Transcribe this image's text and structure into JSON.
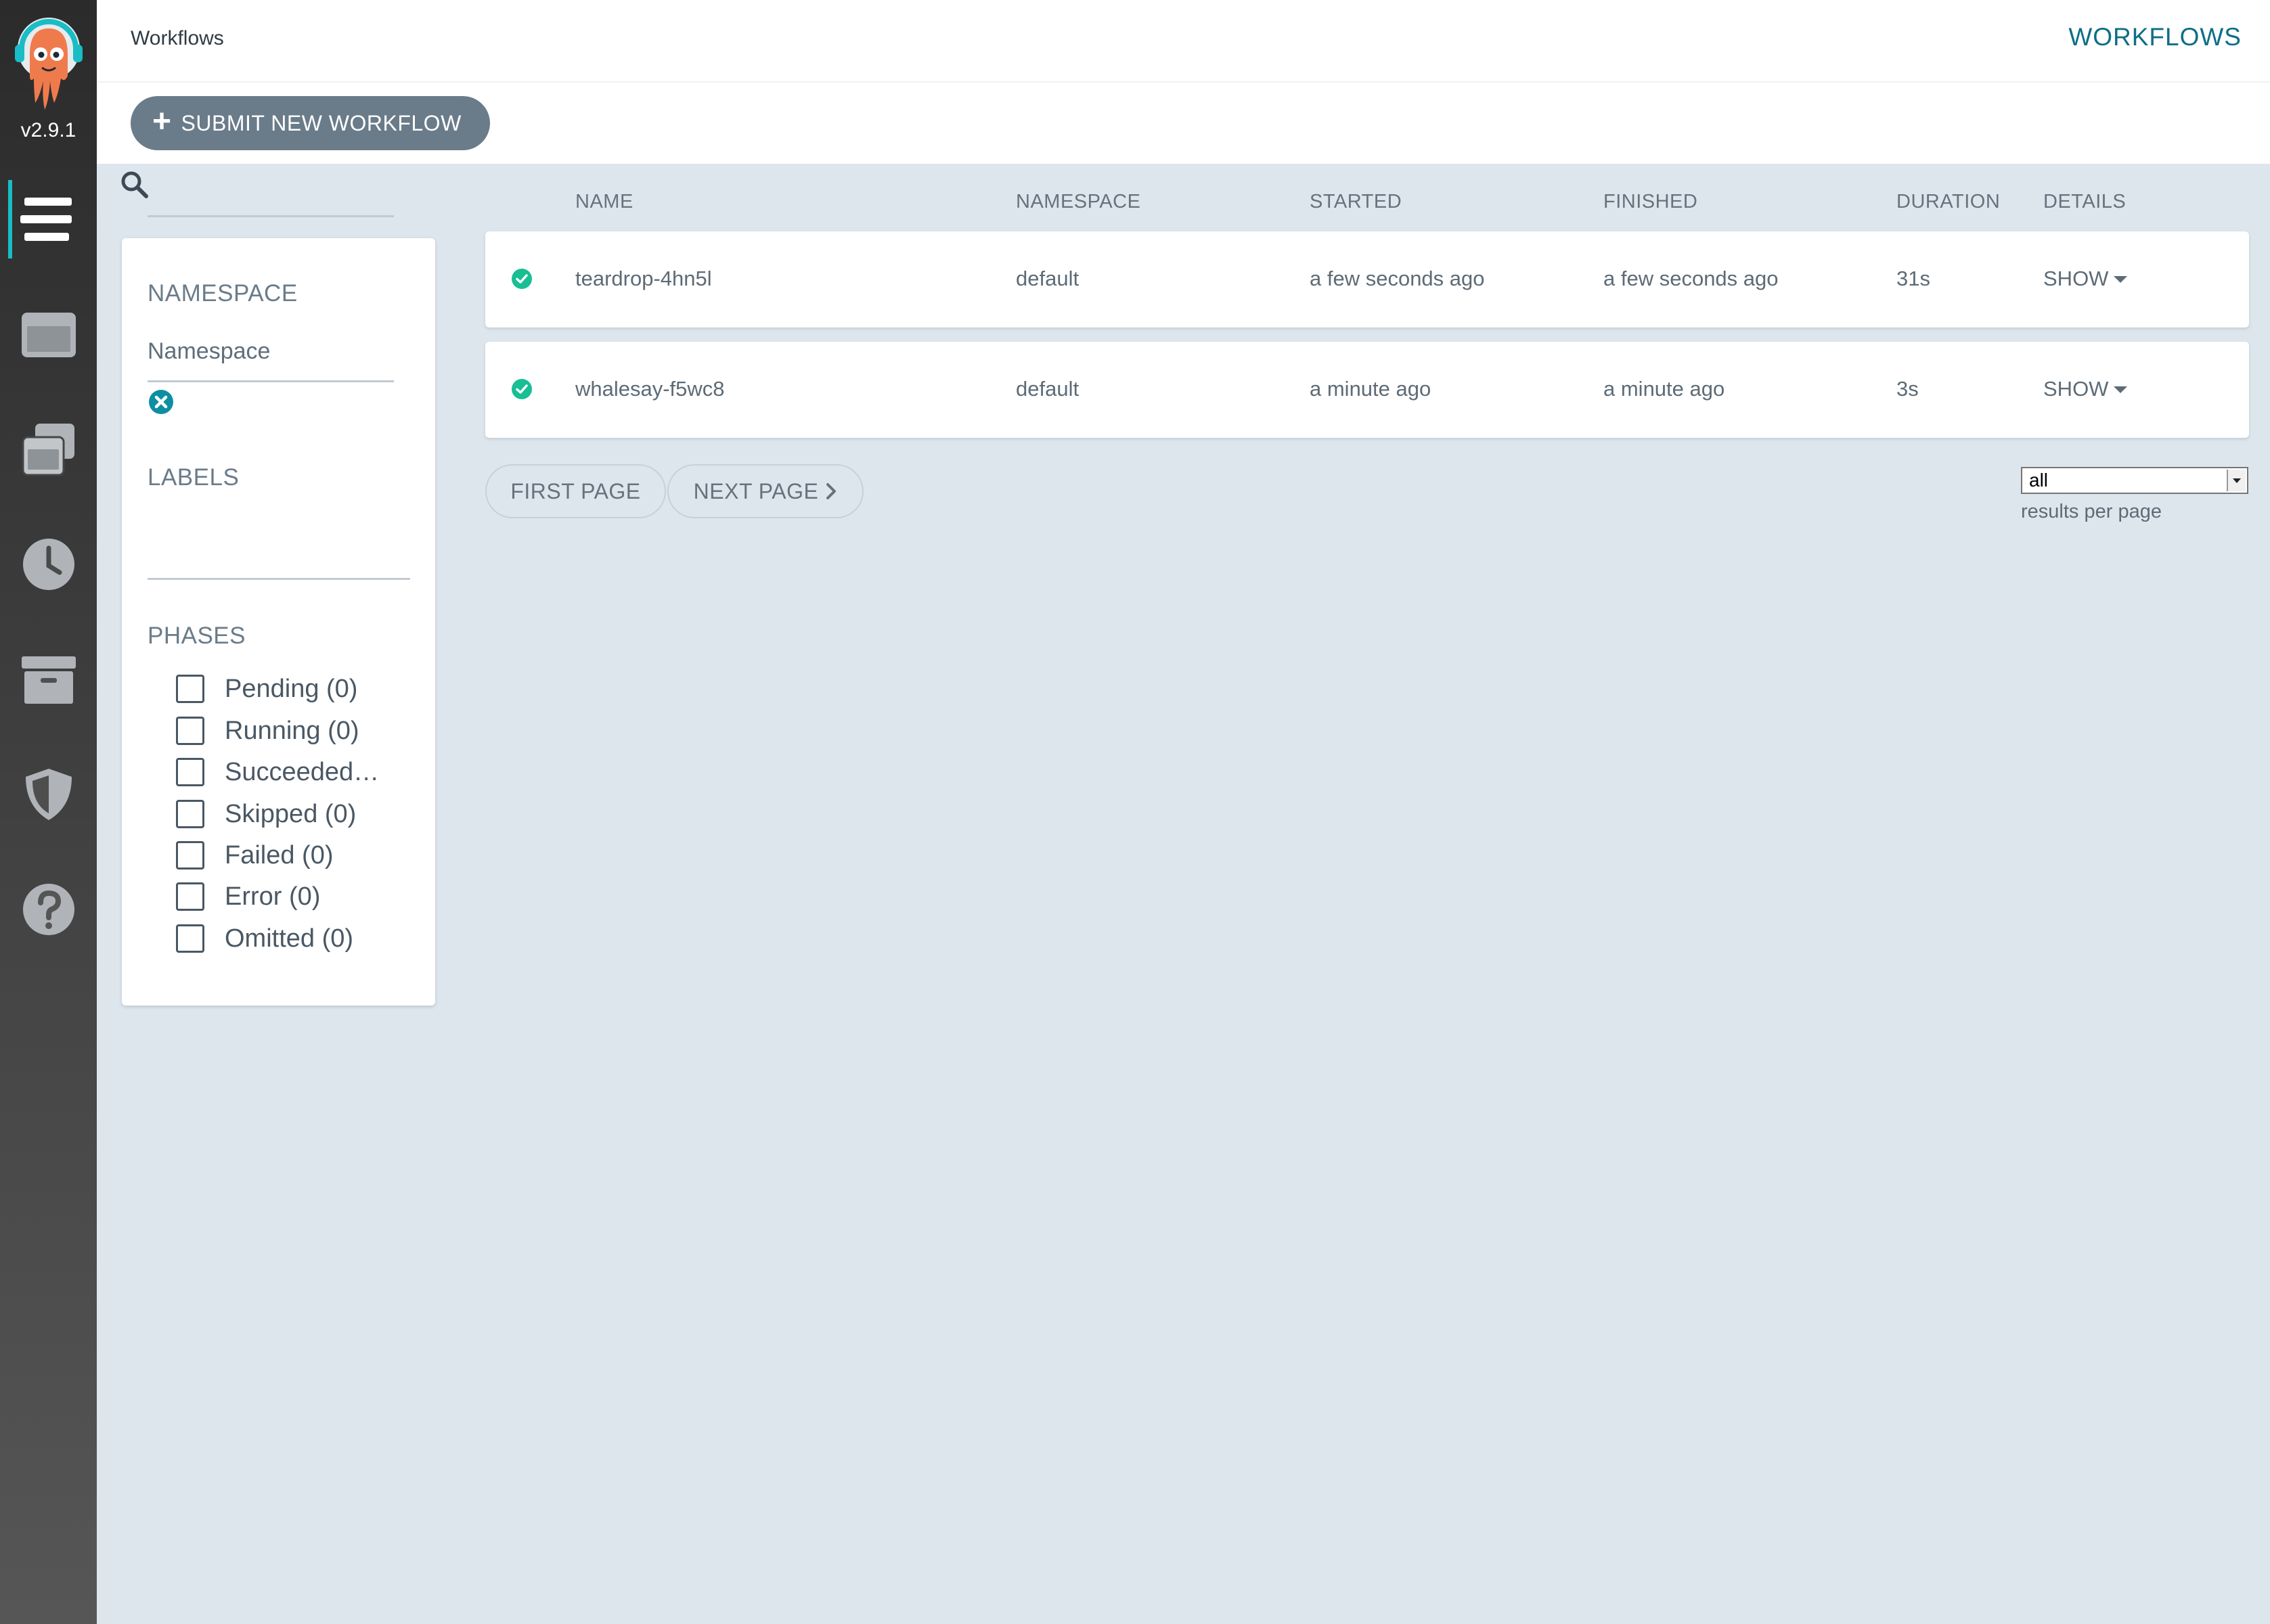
{
  "app": {
    "version": "v2.9.1",
    "brand_color": "#18bdc5"
  },
  "nav": {
    "items": [
      {
        "name": "workflows",
        "icon": "stream-icon",
        "active": true
      },
      {
        "name": "workflow-templates",
        "icon": "window-icon"
      },
      {
        "name": "cluster-workflow-templates",
        "icon": "window-stack-icon"
      },
      {
        "name": "cron-workflows",
        "icon": "clock-icon"
      },
      {
        "name": "archived-workflows",
        "icon": "archive-icon"
      },
      {
        "name": "user",
        "icon": "shield-icon"
      },
      {
        "name": "help",
        "icon": "question-icon"
      }
    ]
  },
  "header": {
    "breadcrumb": "Workflows",
    "title": "WORKFLOWS"
  },
  "actions": {
    "submit_label": "SUBMIT NEW WORKFLOW"
  },
  "filters": {
    "namespace_heading": "NAMESPACE",
    "namespace_placeholder": "Namespace",
    "labels_heading": "LABELS",
    "phases_heading": "PHASES",
    "phases": [
      "Pending (0)",
      "Running (0)",
      "Succeeded…",
      "Skipped (0)",
      "Failed (0)",
      "Error (0)",
      "Omitted (0)"
    ]
  },
  "table": {
    "columns": {
      "name": "NAME",
      "namespace": "NAMESPACE",
      "started": "STARTED",
      "finished": "FINISHED",
      "duration": "DURATION",
      "details": "DETAILS"
    },
    "rows": [
      {
        "status": "succeeded",
        "name": "teardrop-4hn5l",
        "namespace": "default",
        "started": "a few seconds ago",
        "finished": "a few seconds ago",
        "duration": "31s",
        "details": "SHOW"
      },
      {
        "status": "succeeded",
        "name": "whalesay-f5wc8",
        "namespace": "default",
        "started": "a minute ago",
        "finished": "a minute ago",
        "duration": "3s",
        "details": "SHOW"
      }
    ],
    "success_color": "#18be94"
  },
  "pagination": {
    "first_label": "FIRST PAGE",
    "next_label": "NEXT PAGE",
    "per_page_value": "all",
    "per_page_label": "results per page"
  }
}
